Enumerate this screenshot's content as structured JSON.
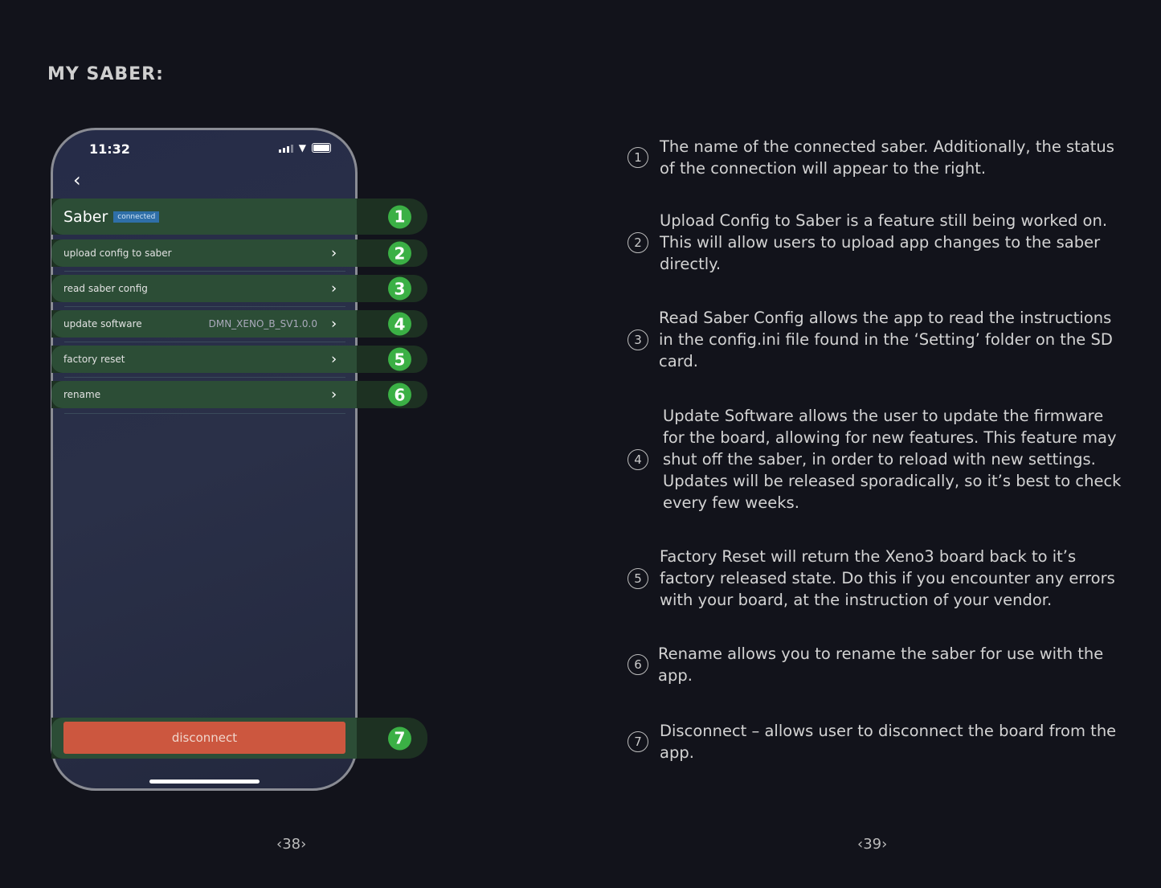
{
  "page_title": "MY SABER:",
  "phone": {
    "time": "11:32",
    "icons": [
      "signal-icon",
      "wifi-icon",
      "battery-icon",
      "back-chevron-icon"
    ],
    "saber_name": "Saber",
    "status_badge": "connected",
    "rows": [
      {
        "label": "upload config to saber",
        "value": ""
      },
      {
        "label": "read saber config",
        "value": ""
      },
      {
        "label": "update software",
        "value": "DMN_XENO_B_SV1.0.0"
      },
      {
        "label": "factory reset",
        "value": ""
      },
      {
        "label": "rename",
        "value": ""
      }
    ],
    "disconnect": "disconnect"
  },
  "callouts": [
    "1",
    "2",
    "3",
    "4",
    "5",
    "6",
    "7"
  ],
  "colors": {
    "callout_green": "#3bb045",
    "disconnect": "#cc573f",
    "badge": "#2f6fa8"
  },
  "descriptions": [
    {
      "num": "1",
      "text": "The name of the connected saber. Additionally, the status of the connection will appear to the right."
    },
    {
      "num": "2",
      "text": "Upload Config to Saber is a feature still being worked on. This will allow users to upload app changes to the saber directly."
    },
    {
      "num": "3",
      "text": "Read Saber Config allows the app to read the instructions in the config.ini file found in the ‘Setting’ folder on the SD card."
    },
    {
      "num": "4",
      "text": "Update Software allows the user to update the firmware for the board, allowing for new features. This feature may shut off the saber, in order to reload with new settings. Updates will be released sporadically, so it’s best to check every few weeks."
    },
    {
      "num": "5",
      "text": "Factory Reset will return the Xeno3 board back to it’s factory released state. Do this if you encounter any errors with your board, at the instruction of your vendor."
    },
    {
      "num": "6",
      "text": "Rename allows you to rename the saber for use with the app."
    },
    {
      "num": "7",
      "text": "Disconnect – allows user to disconnect the board from the app."
    }
  ],
  "page_numbers": {
    "left": "‹38›",
    "right": "‹39›"
  }
}
